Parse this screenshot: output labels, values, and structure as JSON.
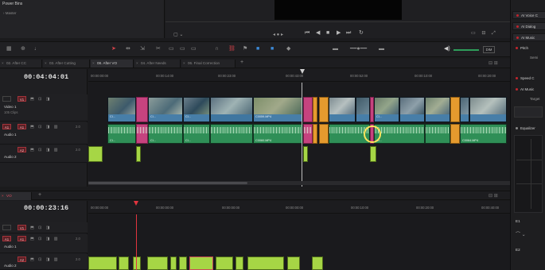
{
  "power_bins": {
    "title": "Power Bins",
    "master": "Master"
  },
  "viewer": {
    "transport_icons": [
      "skip-back-icon",
      "step-back-icon",
      "stop-icon",
      "play-icon",
      "step-forward-icon",
      "loop-icon"
    ]
  },
  "right_panel": {
    "items": [
      {
        "label": "AI Voice C",
        "boxed": true
      },
      {
        "label": "AI Dialog",
        "boxed": true
      },
      {
        "label": "AI Music",
        "boxed": true
      },
      {
        "label": "Pitch",
        "boxed": false
      },
      {
        "label": "Semi",
        "boxed": false
      },
      {
        "label": "Speed C",
        "boxed": false
      },
      {
        "label": "AI Music",
        "boxed": false
      },
      {
        "label": "Target",
        "boxed": false
      },
      {
        "label": "Equalizer",
        "boxed": false
      }
    ],
    "numbers": [
      "E1",
      "E2"
    ]
  },
  "toolbar": {
    "zoom_label": "DIM"
  },
  "tabs": [
    {
      "label": "02. After CC",
      "active": false
    },
    {
      "label": "03. After Cutting",
      "active": false
    },
    {
      "label": "08. After VO",
      "active": true
    },
    {
      "label": "04. After Needs",
      "active": false
    },
    {
      "label": "06. Final Correction",
      "active": false
    }
  ],
  "timeline1": {
    "timecode": "00:04:04:01",
    "ruler": [
      "00:00:00:00",
      "00:00:14:00",
      "00:00:23:00",
      "00:00:43:00",
      "00:00:52:00",
      "00:00:10:00",
      "00:00:20:00"
    ],
    "tracks": {
      "v1": {
        "badge": "V1",
        "name": "Video 1",
        "sub": "105 Clips"
      },
      "a1": {
        "badge": "A1",
        "name": "Audio 1",
        "level": "2.0"
      },
      "a2": {
        "badge": "A2",
        "name": "Audio 2",
        "level": "2.0"
      }
    },
    "clip_labels": [
      "Cl...",
      "Cl...",
      "Cl...",
      "C0059.MP4",
      "C0060.MP4",
      "Cl...",
      "C0064.MP4"
    ]
  },
  "timeline2": {
    "tab_label": "VO",
    "timecode": "00:00:23:16",
    "ruler": [
      "00:00:00:00",
      "00:00:00:00",
      "00:00:00:00",
      "00:00:00:00",
      "00:00:10:00",
      "00:00:20:00",
      "00:00:40:00"
    ],
    "tracks": {
      "v1": {
        "badge": "V1"
      },
      "a1": {
        "badge": "A1",
        "name": "Audio 1",
        "level": "2.0"
      },
      "a2": {
        "badge": "A2",
        "name": "Audio 2",
        "level": "2.0"
      }
    }
  },
  "colors": {
    "video_clip": "#477ea8",
    "audio_clip": "#2f8f57",
    "marker_pink": "#c6437f",
    "marker_orange": "#e59a2e",
    "vo_clip": "#a6d645",
    "playhead": "#e2343f"
  }
}
